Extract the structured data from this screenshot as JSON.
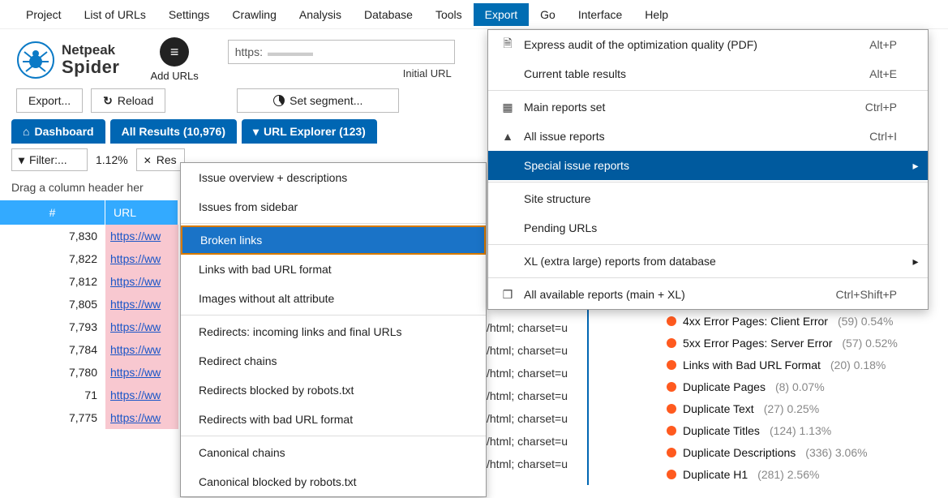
{
  "menu": {
    "items": [
      "Project",
      "List of URLs",
      "Settings",
      "Crawling",
      "Analysis",
      "Database",
      "Tools",
      "Export",
      "Go",
      "Interface",
      "Help"
    ],
    "activeIndex": 7
  },
  "logo": {
    "top": "Netpeak",
    "bottom": "Spider"
  },
  "addUrls": {
    "label": "Add URLs"
  },
  "urlField": {
    "value": "https:",
    "caption": "Initial URL"
  },
  "toolbar": {
    "export": "Export...",
    "reload": "Reload",
    "segment": "Set segment..."
  },
  "tabs": {
    "dashboard": "Dashboard",
    "allResults": "All Results (10,976)",
    "urlExplorer": "URL Explorer (123)"
  },
  "filterRow": {
    "filterLabel": "Filter:...",
    "percent": "1.12%",
    "reset": "Res"
  },
  "dragHint": "Drag a column header her",
  "table": {
    "headers": {
      "num": "#",
      "url": "URL"
    },
    "rows": [
      {
        "num": "7,830",
        "url": "https://ww"
      },
      {
        "num": "7,822",
        "url": "https://ww"
      },
      {
        "num": "7,812",
        "url": "https://ww"
      },
      {
        "num": "7,805",
        "url": "https://ww"
      },
      {
        "num": "7,793",
        "url": "https://ww"
      },
      {
        "num": "7,784",
        "url": "https://ww"
      },
      {
        "num": "7,780",
        "url": "https://ww"
      },
      {
        "num": "71",
        "url": "https://ww"
      },
      {
        "num": "7,775",
        "url": "https://ww"
      }
    ]
  },
  "contentType": {
    "value": "/html; charset=u"
  },
  "submenu": {
    "items": [
      "Issue overview + descriptions",
      "Issues from sidebar",
      "Broken links",
      "Links with bad URL format",
      "Images without alt attribute",
      "Redirects: incoming links and final URLs",
      "Redirect chains",
      "Redirects blocked by robots.txt",
      "Redirects with bad URL format",
      "Canonical chains",
      "Canonical blocked by robots.txt"
    ],
    "selectedIndex": 2,
    "separatorsAfter": [
      1,
      4,
      8
    ]
  },
  "exportMenu": {
    "items": [
      {
        "icon": "pdf",
        "label": "Express audit of the optimization quality (PDF)",
        "shortcut": "Alt+P"
      },
      {
        "icon": "",
        "label": "Current table results",
        "shortcut": "Alt+E"
      },
      {
        "sep": true
      },
      {
        "icon": "grid",
        "label": "Main reports set",
        "shortcut": "Ctrl+P"
      },
      {
        "icon": "warn",
        "label": "All issue reports",
        "shortcut": "Ctrl+I"
      },
      {
        "icon": "",
        "label": "Special issue reports",
        "shortcut": "",
        "arrow": true,
        "selected": true
      },
      {
        "sep": true
      },
      {
        "icon": "",
        "label": "Site structure",
        "shortcut": ""
      },
      {
        "icon": "",
        "label": "Pending URLs",
        "shortcut": ""
      },
      {
        "sep": true
      },
      {
        "icon": "",
        "label": "XL (extra large) reports from database",
        "shortcut": "",
        "arrow": true
      },
      {
        "sep": true
      },
      {
        "icon": "cube",
        "label": "All available reports (main + XL)",
        "shortcut": "Ctrl+Shift+P"
      }
    ]
  },
  "issues": {
    "items": [
      {
        "label": "4xx Error Pages: Client Error",
        "meta": "(59) 0.54%"
      },
      {
        "label": "5xx Error Pages: Server Error",
        "meta": "(57) 0.52%"
      },
      {
        "label": "Links with Bad URL Format",
        "meta": "(20) 0.18%"
      },
      {
        "label": "Duplicate Pages",
        "meta": "(8) 0.07%"
      },
      {
        "label": "Duplicate Text",
        "meta": "(27) 0.25%"
      },
      {
        "label": "Duplicate Titles",
        "meta": "(124) 1.13%"
      },
      {
        "label": "Duplicate Descriptions",
        "meta": "(336) 3.06%"
      },
      {
        "label": "Duplicate H1",
        "meta": "(281) 2.56%"
      }
    ]
  }
}
